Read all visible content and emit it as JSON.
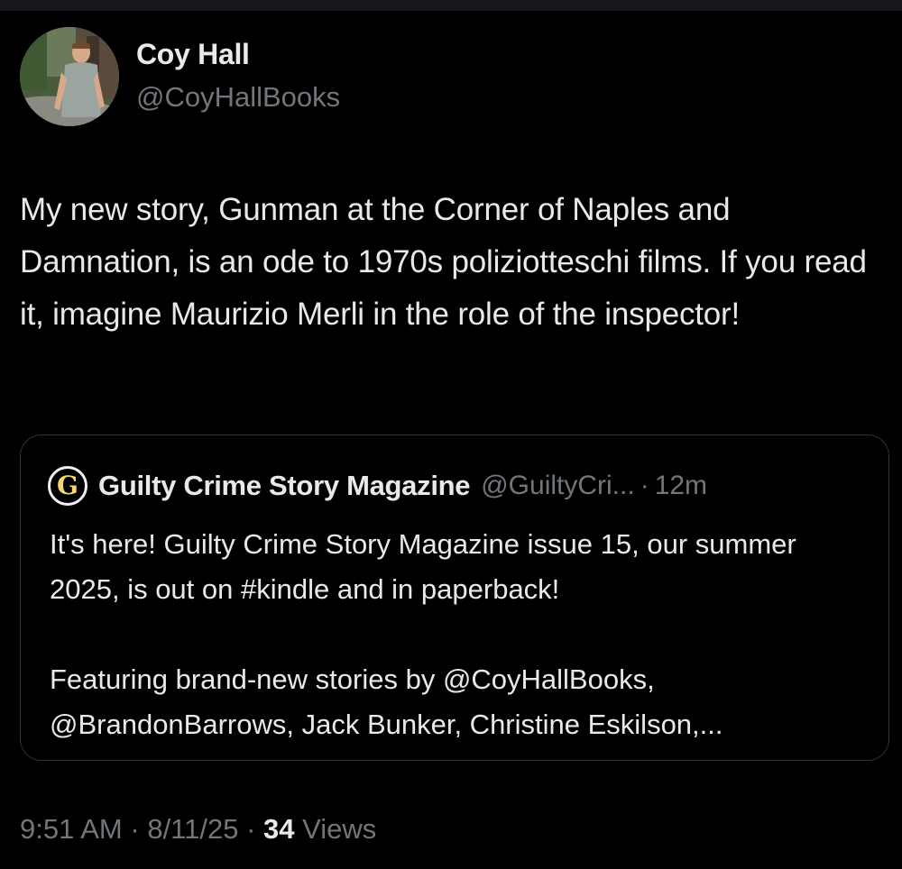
{
  "author": {
    "name": "Coy Hall",
    "handle": "@CoyHallBooks"
  },
  "tweet": {
    "text": "My new story, Gunman at the Corner of Naples and Damnation, is an ode to 1970s poliziotteschi films. If you read it, imagine Maurizio Merli in the role of the inspector!"
  },
  "quoted": {
    "name": "Guilty Crime Story Magazine",
    "handle": "@GuiltyCri...",
    "separator": "·",
    "time": "12m",
    "text": "It's here! Guilty Crime Story Magazine issue 15, our summer 2025, is out on #kindle and in paperback!\n\nFeaturing brand-new stories by @CoyHallBooks, @BrandonBarrows, Jack Bunker, Christine Eskilson,...",
    "logo_letter": "G"
  },
  "meta": {
    "time": "9:51 AM",
    "date": "8/11/25",
    "separator": "·",
    "views_count": "34",
    "views_label": "Views"
  },
  "colors": {
    "background": "#000000",
    "primary_text": "#e7e9ea",
    "secondary_text": "#71767b",
    "border": "#2f3336"
  }
}
